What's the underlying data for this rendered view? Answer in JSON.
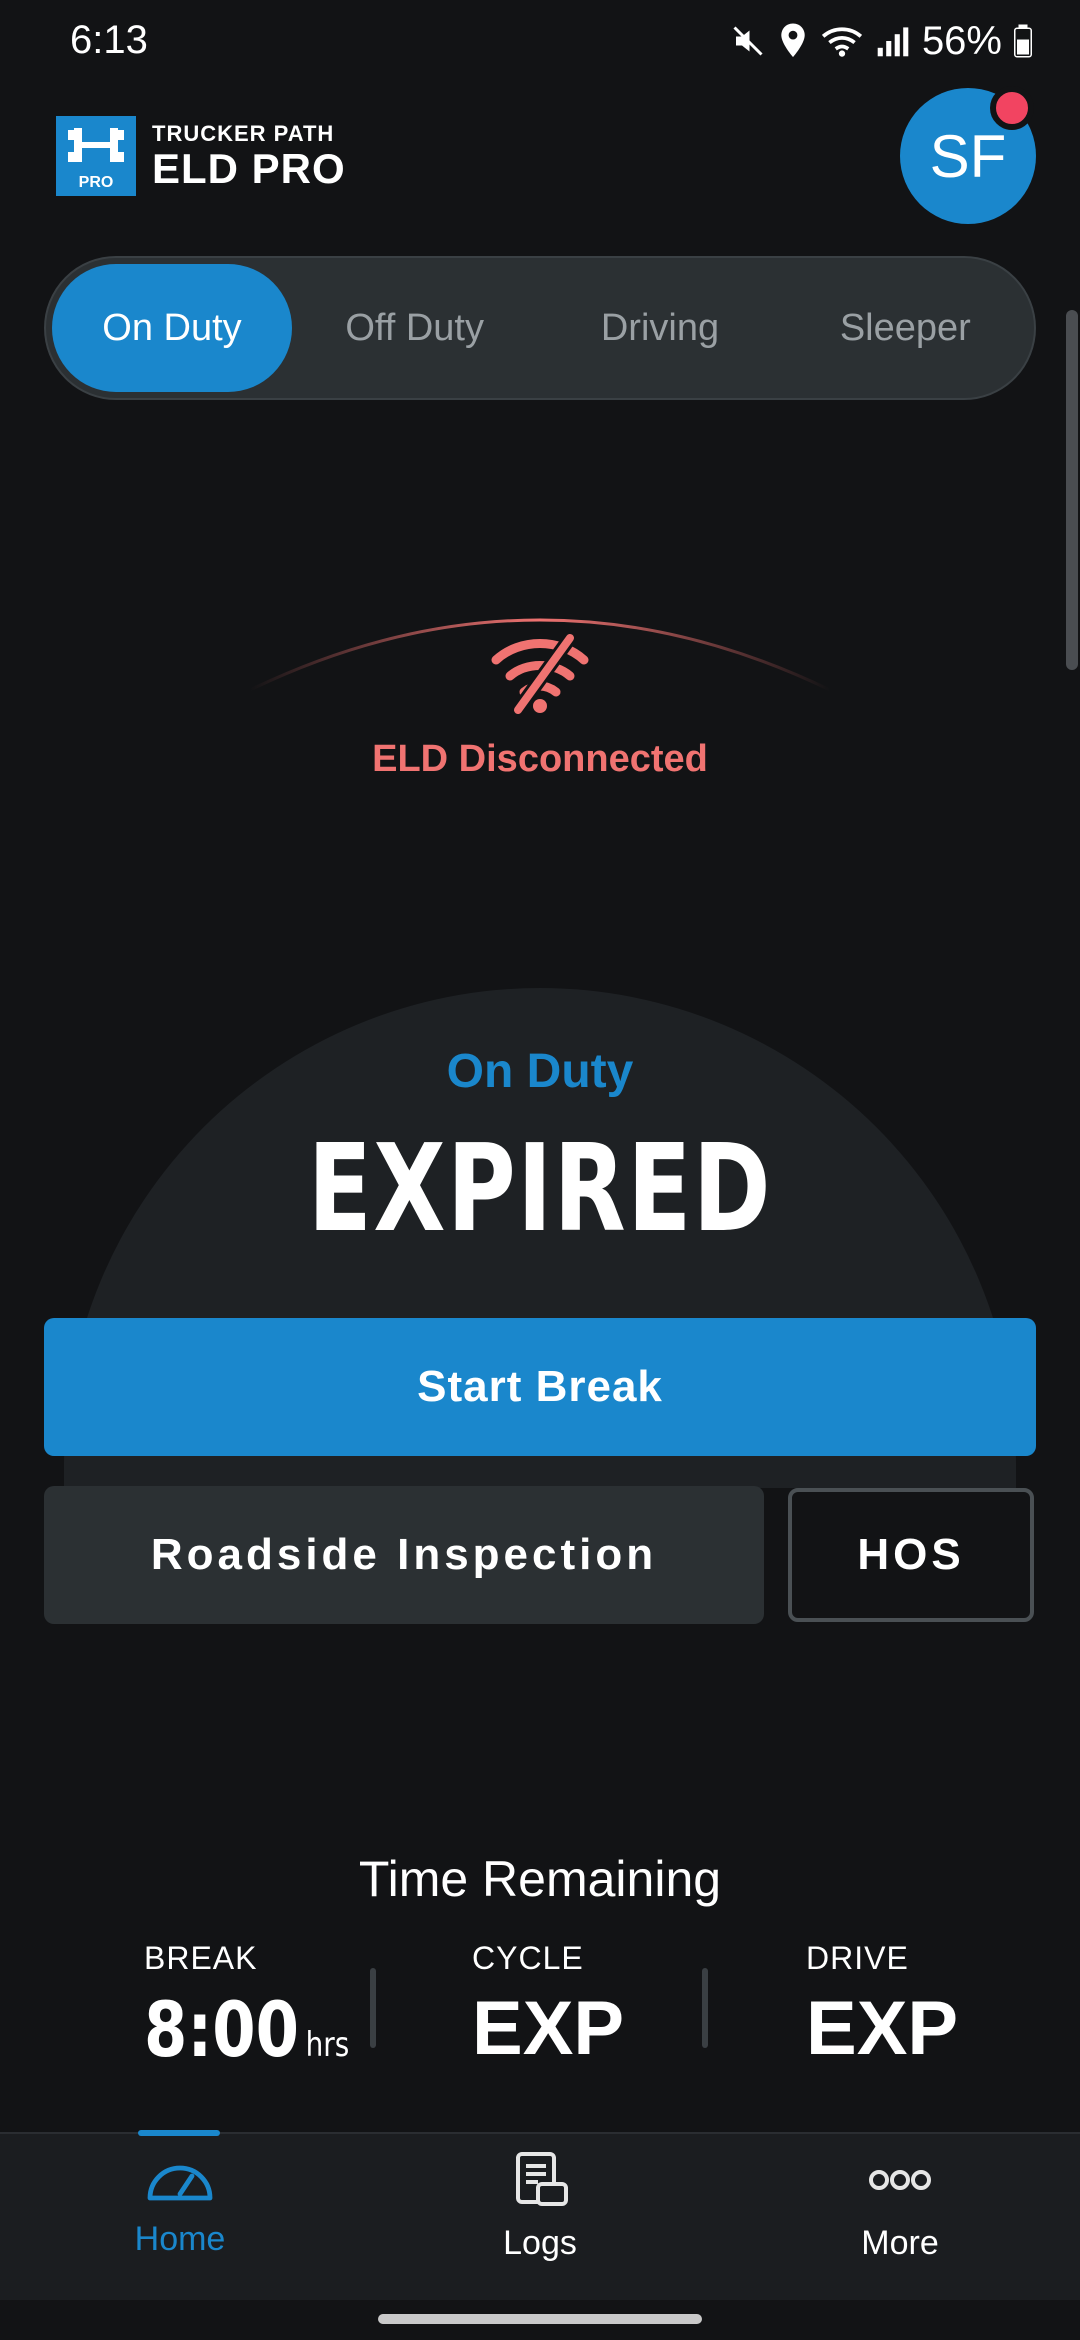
{
  "status_bar": {
    "time": "6:13",
    "battery": "56%",
    "icons": [
      "mute-icon",
      "location-icon",
      "wifi-icon",
      "signal-icon",
      "battery-icon"
    ]
  },
  "header": {
    "logo_small": "TRUCKER PATH",
    "logo_big": "ELD PRO",
    "logo_badge": "PRO",
    "avatar_initials": "SF",
    "notification_color": "#f24461"
  },
  "duty_tabs": {
    "items": [
      "On Duty",
      "Off Duty",
      "Driving",
      "Sleeper"
    ],
    "active": "On Duty"
  },
  "connection": {
    "status_text": "ELD Disconnected",
    "icon": "wifi-off-icon",
    "color": "#f07371"
  },
  "current_status": {
    "label": "On Duty",
    "value": "EXPIRED"
  },
  "actions": {
    "start_break": "Start Break",
    "roadside_inspection": "Roadside Inspection",
    "hos": "HOS"
  },
  "time_remaining": {
    "title": "Time Remaining",
    "metrics": [
      {
        "label": "BREAK",
        "value": "8:00",
        "unit": "hrs"
      },
      {
        "label": "CYCLE",
        "value": "EXP"
      },
      {
        "label": "DRIVE",
        "value": "EXP"
      }
    ]
  },
  "bottom_nav": {
    "items": [
      {
        "label": "Home",
        "icon": "speedometer-icon",
        "active": true
      },
      {
        "label": "Logs",
        "icon": "logs-icon"
      },
      {
        "label": "More",
        "icon": "more-icon"
      }
    ]
  },
  "colors": {
    "accent": "#1a87cc",
    "background": "#121315",
    "error": "#f07371"
  }
}
